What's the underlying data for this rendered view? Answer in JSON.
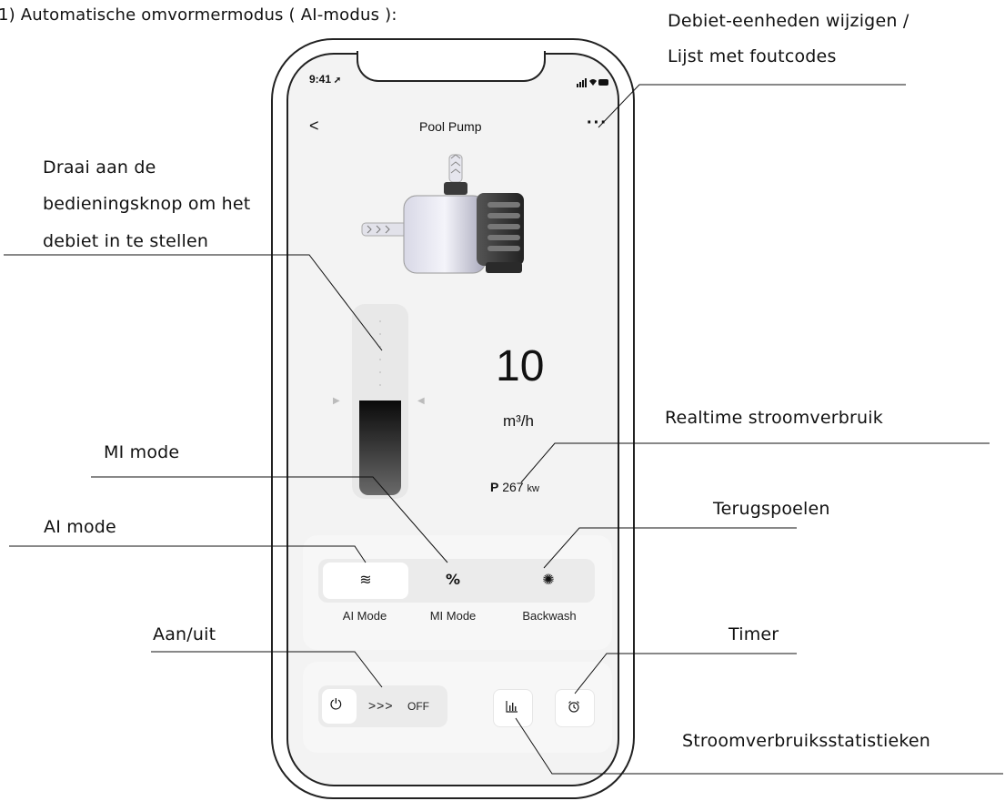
{
  "annotations": {
    "heading": "1) Automatische omvormermodus ( AI-modus ):",
    "flow_units_line1": "Debiet-eenheden wijzigen /",
    "flow_units_line2": "Lijst met foutcodes",
    "knob_line1": "Draai aan de",
    "knob_line2": "bedieningsknop om het",
    "knob_line3": "debiet in te stellen",
    "realtime_power": "Realtime stroomverbruik",
    "mi_mode": "MI mode",
    "ai_mode": "AI mode",
    "backwash": "Terugspoelen",
    "power_toggle": "Aan/uit",
    "timer": "Timer",
    "stats": "Stroomverbruiksstatistieken"
  },
  "phone": {
    "status_time": "9:41",
    "header": {
      "back": "<",
      "title": "Pool Pump",
      "more": "···"
    },
    "flow": {
      "value": "10",
      "unit": "m³/h",
      "level_fraction": 0.5
    },
    "power": {
      "prefix": "P",
      "value": "267",
      "unit": "kw"
    },
    "modes": [
      {
        "label": "AI Mode",
        "icon": "waves-icon",
        "glyph": "≋",
        "active": true
      },
      {
        "label": "MI Mode",
        "icon": "percent-icon",
        "glyph": "%",
        "active": false
      },
      {
        "label": "Backwash",
        "icon": "backwash-icon",
        "glyph": "✺",
        "active": false
      }
    ],
    "controls": {
      "power_glyph": "⏻",
      "arrows": ">>>",
      "state": "OFF",
      "stats_icon": "bar-chart-icon",
      "timer_icon": "alarm-clock-icon"
    }
  }
}
